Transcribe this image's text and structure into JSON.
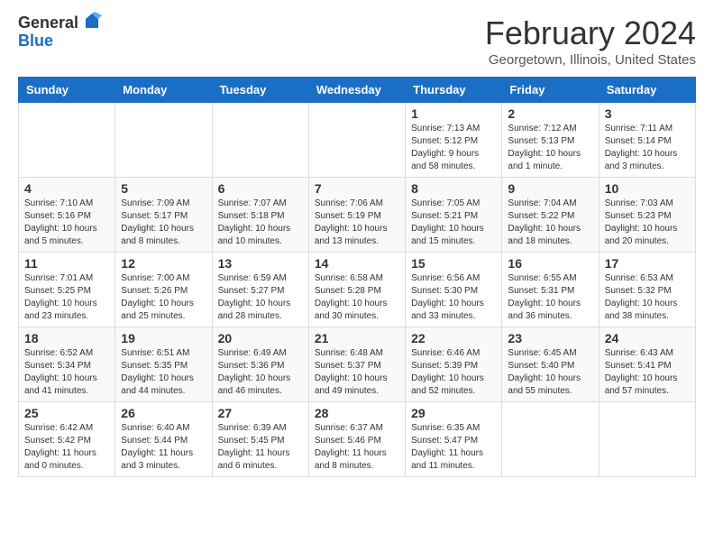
{
  "header": {
    "logo_general": "General",
    "logo_blue": "Blue",
    "month_title": "February 2024",
    "location": "Georgetown, Illinois, United States"
  },
  "weekdays": [
    "Sunday",
    "Monday",
    "Tuesday",
    "Wednesday",
    "Thursday",
    "Friday",
    "Saturday"
  ],
  "weeks": [
    [
      {
        "day": "",
        "info": ""
      },
      {
        "day": "",
        "info": ""
      },
      {
        "day": "",
        "info": ""
      },
      {
        "day": "",
        "info": ""
      },
      {
        "day": "1",
        "info": "Sunrise: 7:13 AM\nSunset: 5:12 PM\nDaylight: 9 hours\nand 58 minutes."
      },
      {
        "day": "2",
        "info": "Sunrise: 7:12 AM\nSunset: 5:13 PM\nDaylight: 10 hours\nand 1 minute."
      },
      {
        "day": "3",
        "info": "Sunrise: 7:11 AM\nSunset: 5:14 PM\nDaylight: 10 hours\nand 3 minutes."
      }
    ],
    [
      {
        "day": "4",
        "info": "Sunrise: 7:10 AM\nSunset: 5:16 PM\nDaylight: 10 hours\nand 5 minutes."
      },
      {
        "day": "5",
        "info": "Sunrise: 7:09 AM\nSunset: 5:17 PM\nDaylight: 10 hours\nand 8 minutes."
      },
      {
        "day": "6",
        "info": "Sunrise: 7:07 AM\nSunset: 5:18 PM\nDaylight: 10 hours\nand 10 minutes."
      },
      {
        "day": "7",
        "info": "Sunrise: 7:06 AM\nSunset: 5:19 PM\nDaylight: 10 hours\nand 13 minutes."
      },
      {
        "day": "8",
        "info": "Sunrise: 7:05 AM\nSunset: 5:21 PM\nDaylight: 10 hours\nand 15 minutes."
      },
      {
        "day": "9",
        "info": "Sunrise: 7:04 AM\nSunset: 5:22 PM\nDaylight: 10 hours\nand 18 minutes."
      },
      {
        "day": "10",
        "info": "Sunrise: 7:03 AM\nSunset: 5:23 PM\nDaylight: 10 hours\nand 20 minutes."
      }
    ],
    [
      {
        "day": "11",
        "info": "Sunrise: 7:01 AM\nSunset: 5:25 PM\nDaylight: 10 hours\nand 23 minutes."
      },
      {
        "day": "12",
        "info": "Sunrise: 7:00 AM\nSunset: 5:26 PM\nDaylight: 10 hours\nand 25 minutes."
      },
      {
        "day": "13",
        "info": "Sunrise: 6:59 AM\nSunset: 5:27 PM\nDaylight: 10 hours\nand 28 minutes."
      },
      {
        "day": "14",
        "info": "Sunrise: 6:58 AM\nSunset: 5:28 PM\nDaylight: 10 hours\nand 30 minutes."
      },
      {
        "day": "15",
        "info": "Sunrise: 6:56 AM\nSunset: 5:30 PM\nDaylight: 10 hours\nand 33 minutes."
      },
      {
        "day": "16",
        "info": "Sunrise: 6:55 AM\nSunset: 5:31 PM\nDaylight: 10 hours\nand 36 minutes."
      },
      {
        "day": "17",
        "info": "Sunrise: 6:53 AM\nSunset: 5:32 PM\nDaylight: 10 hours\nand 38 minutes."
      }
    ],
    [
      {
        "day": "18",
        "info": "Sunrise: 6:52 AM\nSunset: 5:34 PM\nDaylight: 10 hours\nand 41 minutes."
      },
      {
        "day": "19",
        "info": "Sunrise: 6:51 AM\nSunset: 5:35 PM\nDaylight: 10 hours\nand 44 minutes."
      },
      {
        "day": "20",
        "info": "Sunrise: 6:49 AM\nSunset: 5:36 PM\nDaylight: 10 hours\nand 46 minutes."
      },
      {
        "day": "21",
        "info": "Sunrise: 6:48 AM\nSunset: 5:37 PM\nDaylight: 10 hours\nand 49 minutes."
      },
      {
        "day": "22",
        "info": "Sunrise: 6:46 AM\nSunset: 5:39 PM\nDaylight: 10 hours\nand 52 minutes."
      },
      {
        "day": "23",
        "info": "Sunrise: 6:45 AM\nSunset: 5:40 PM\nDaylight: 10 hours\nand 55 minutes."
      },
      {
        "day": "24",
        "info": "Sunrise: 6:43 AM\nSunset: 5:41 PM\nDaylight: 10 hours\nand 57 minutes."
      }
    ],
    [
      {
        "day": "25",
        "info": "Sunrise: 6:42 AM\nSunset: 5:42 PM\nDaylight: 11 hours\nand 0 minutes."
      },
      {
        "day": "26",
        "info": "Sunrise: 6:40 AM\nSunset: 5:44 PM\nDaylight: 11 hours\nand 3 minutes."
      },
      {
        "day": "27",
        "info": "Sunrise: 6:39 AM\nSunset: 5:45 PM\nDaylight: 11 hours\nand 6 minutes."
      },
      {
        "day": "28",
        "info": "Sunrise: 6:37 AM\nSunset: 5:46 PM\nDaylight: 11 hours\nand 8 minutes."
      },
      {
        "day": "29",
        "info": "Sunrise: 6:35 AM\nSunset: 5:47 PM\nDaylight: 11 hours\nand 11 minutes."
      },
      {
        "day": "",
        "info": ""
      },
      {
        "day": "",
        "info": ""
      }
    ]
  ]
}
